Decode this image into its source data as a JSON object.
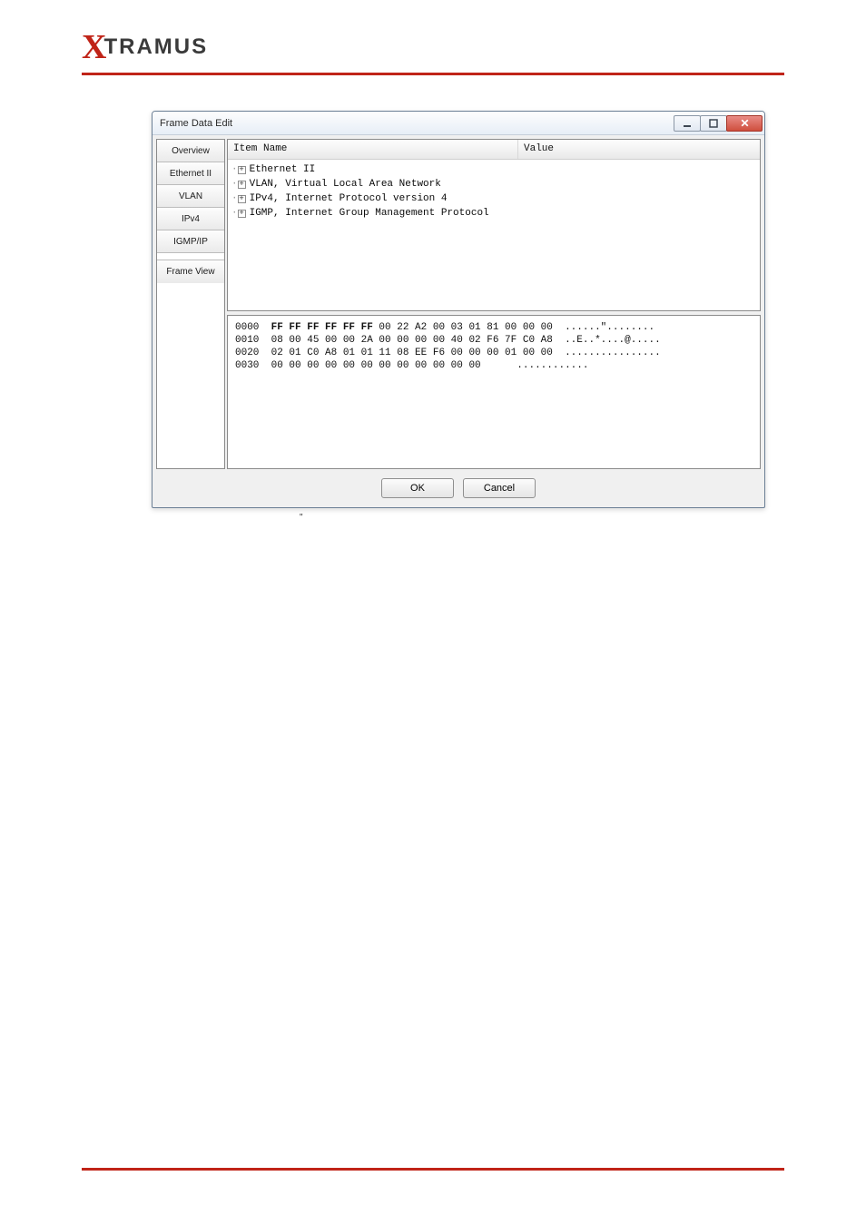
{
  "brand": {
    "x": "X",
    "rest": "TRAMUS"
  },
  "dialog": {
    "title": "Frame Data Edit",
    "sidebar": {
      "items": [
        {
          "label": "Overview"
        },
        {
          "label": "Ethernet II"
        },
        {
          "label": "VLAN"
        },
        {
          "label": "IPv4"
        },
        {
          "label": "IGMP/IP"
        },
        {
          "label": "Frame View"
        }
      ]
    },
    "tree": {
      "headers": {
        "name": "Item Name",
        "value": "Value"
      },
      "rows": [
        {
          "label": "Ethernet II"
        },
        {
          "label": "VLAN, Virtual Local Area Network"
        },
        {
          "label": "IPv4, Internet Protocol version 4"
        },
        {
          "label": "IGMP, Internet Group Management Protocol"
        }
      ]
    },
    "hex": {
      "lines": [
        {
          "offset": "0000",
          "bold": "FF FF FF FF FF FF",
          "rest": " 00 22 A2 00 03 01 81 00 00 00",
          "ascii": "  ......\"........"
        },
        {
          "offset": "0010",
          "bold": "",
          "rest": "08 00 45 00 00 2A 00 00 00 00 40 02 F6 7F C0 A8",
          "ascii": "  ..E..*....@....."
        },
        {
          "offset": "0020",
          "bold": "",
          "rest": "02 01 C0 A8 01 01 11 08 EE F6 00 00 00 01 00 00",
          "ascii": "  ................"
        },
        {
          "offset": "0030",
          "bold": "",
          "rest": "00 00 00 00 00 00 00 00 00 00 00 00",
          "ascii": "      ............"
        }
      ]
    },
    "buttons": {
      "ok": "OK",
      "cancel": "Cancel"
    }
  },
  "stray_mark": "\""
}
